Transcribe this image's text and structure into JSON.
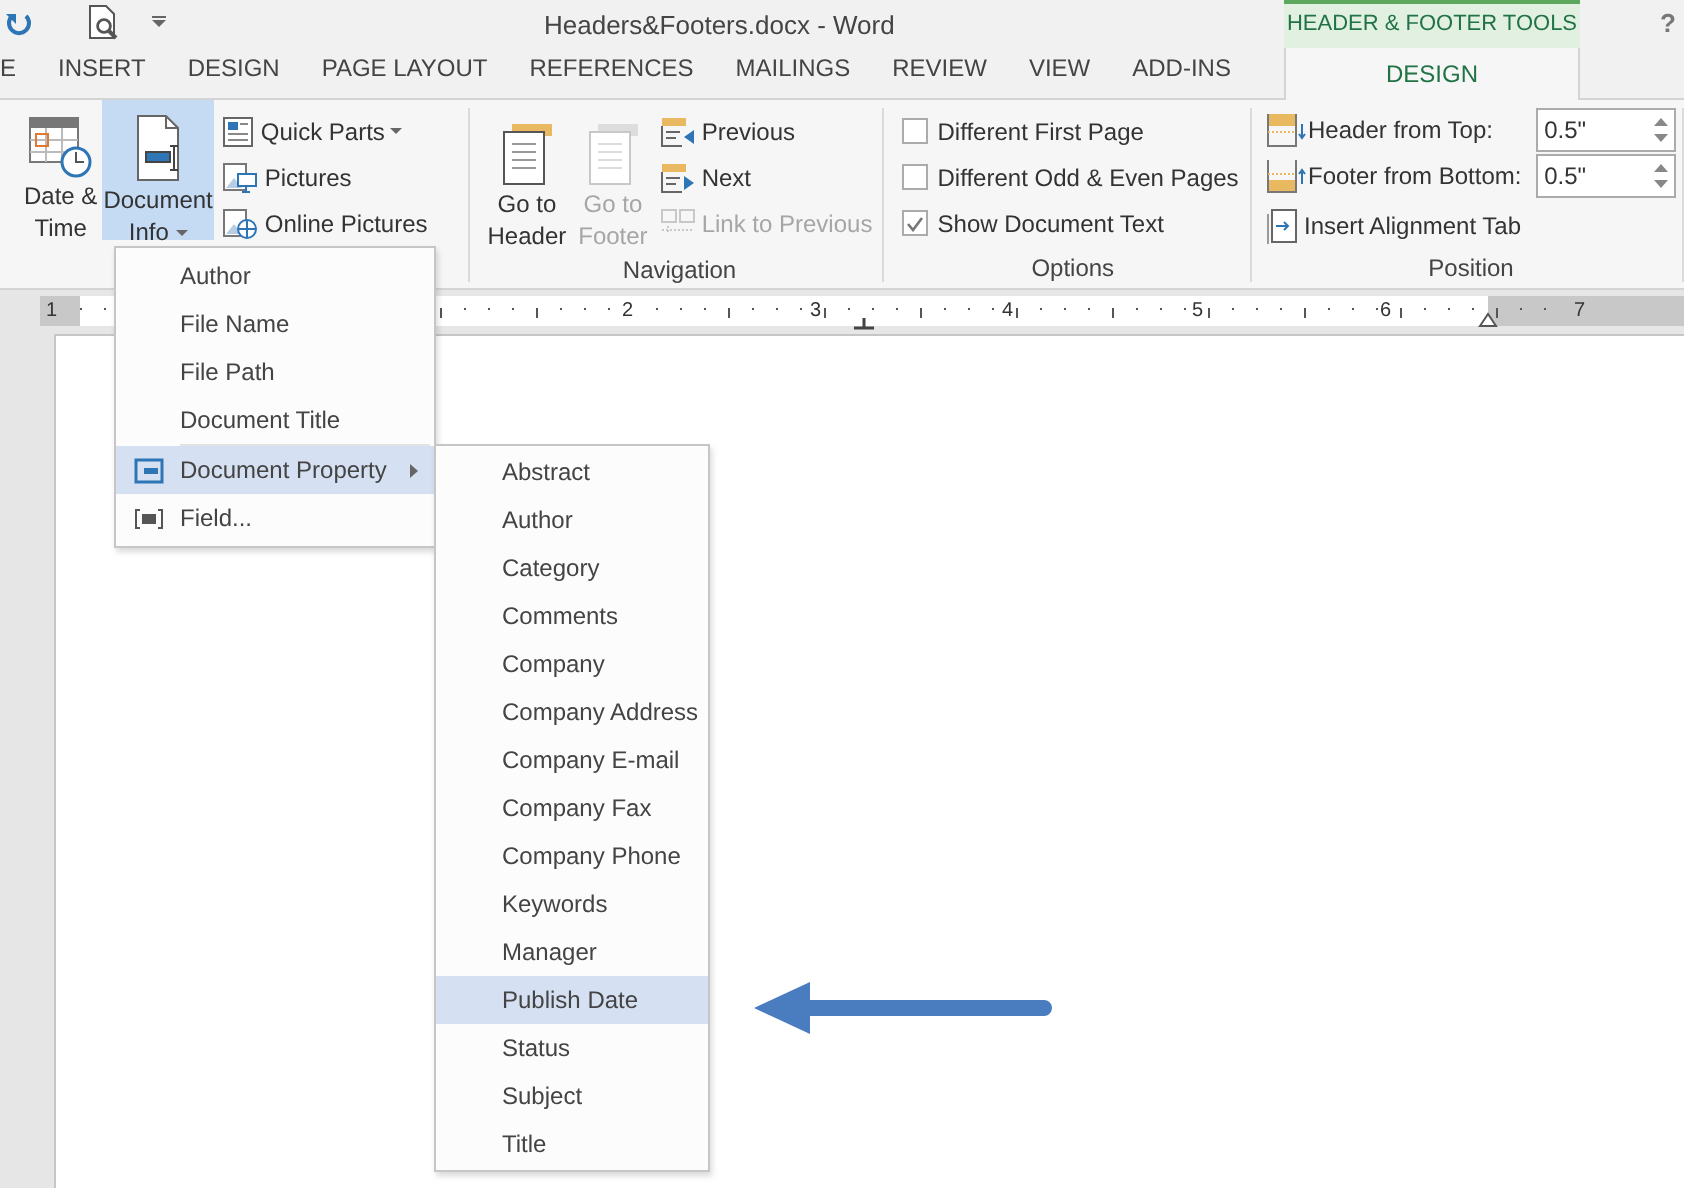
{
  "title_bar": {
    "title": "Headers&Footers.docx - Word",
    "context_label": "HEADER & FOOTER TOOLS",
    "help": "?"
  },
  "tabs": [
    {
      "label": "E",
      "selected": false,
      "kind": "normal"
    },
    {
      "label": "INSERT",
      "selected": false,
      "kind": "normal"
    },
    {
      "label": "DESIGN",
      "selected": false,
      "kind": "normal"
    },
    {
      "label": "PAGE LAYOUT",
      "selected": false,
      "kind": "normal"
    },
    {
      "label": "REFERENCES",
      "selected": false,
      "kind": "normal"
    },
    {
      "label": "MAILINGS",
      "selected": false,
      "kind": "normal"
    },
    {
      "label": "REVIEW",
      "selected": false,
      "kind": "normal"
    },
    {
      "label": "VIEW",
      "selected": false,
      "kind": "normal"
    },
    {
      "label": "ADD-INS",
      "selected": false,
      "kind": "normal"
    },
    {
      "label": "DESIGN",
      "selected": true,
      "kind": "contextual"
    }
  ],
  "insert_group": {
    "large_buttons": [
      {
        "lines": [
          "Date &",
          "Time"
        ],
        "selected": false,
        "dropdown": false
      },
      {
        "lines": [
          "Document",
          "Info"
        ],
        "selected": true,
        "dropdown": true
      }
    ],
    "small_buttons": [
      {
        "label": "Quick Parts",
        "dropdown": true
      },
      {
        "label": "Pictures",
        "dropdown": false
      },
      {
        "label": "Online Pictures",
        "dropdown": false
      }
    ]
  },
  "navigation": {
    "label": "Navigation",
    "large_buttons": [
      {
        "lines": [
          "Go to",
          "Header"
        ],
        "disabled": false
      },
      {
        "lines": [
          "Go to",
          "Footer"
        ],
        "disabled": true
      }
    ],
    "small_buttons": [
      {
        "label": "Previous",
        "disabled": false
      },
      {
        "label": "Next",
        "disabled": false
      },
      {
        "label": "Link to Previous",
        "disabled": true
      }
    ]
  },
  "options": {
    "label": "Options",
    "checkboxes": [
      {
        "label": "Different First Page",
        "checked": false
      },
      {
        "label": "Different Odd & Even Pages",
        "checked": false
      },
      {
        "label": "Show Document Text",
        "checked": true
      }
    ]
  },
  "position": {
    "label": "Position",
    "spinners": [
      {
        "label": "Header from Top:",
        "value": "0.5\""
      },
      {
        "label": "Footer from Bottom:",
        "value": "0.5\""
      }
    ],
    "button": {
      "label": "Insert Alignment Tab"
    }
  },
  "ruler": {
    "numbers": [
      "1",
      "2",
      "3",
      "4",
      "5",
      "6",
      "7"
    ]
  },
  "menu": {
    "items": [
      {
        "label": "Author",
        "selected": false,
        "kind": "plain",
        "submenu": false
      },
      {
        "label": "File Name",
        "selected": false,
        "kind": "plain",
        "submenu": false
      },
      {
        "label": "File Path",
        "selected": false,
        "kind": "plain",
        "submenu": false
      },
      {
        "label": "Document Title",
        "selected": false,
        "kind": "plain",
        "submenu": false
      },
      {
        "label": "Document Property",
        "selected": true,
        "kind": "property",
        "submenu": true
      },
      {
        "label": "Field...",
        "selected": false,
        "kind": "field",
        "submenu": false
      }
    ]
  },
  "submenu": {
    "items": [
      {
        "label": "Abstract",
        "selected": false
      },
      {
        "label": "Author",
        "selected": false
      },
      {
        "label": "Category",
        "selected": false
      },
      {
        "label": "Comments",
        "selected": false
      },
      {
        "label": "Company",
        "selected": false
      },
      {
        "label": "Company Address",
        "selected": false
      },
      {
        "label": "Company E-mail",
        "selected": false
      },
      {
        "label": "Company Fax",
        "selected": false
      },
      {
        "label": "Company Phone",
        "selected": false
      },
      {
        "label": "Keywords",
        "selected": false
      },
      {
        "label": "Manager",
        "selected": false
      },
      {
        "label": "Publish Date",
        "selected": true
      },
      {
        "label": "Status",
        "selected": false
      },
      {
        "label": "Subject",
        "selected": false
      },
      {
        "label": "Title",
        "selected": false
      }
    ]
  }
}
